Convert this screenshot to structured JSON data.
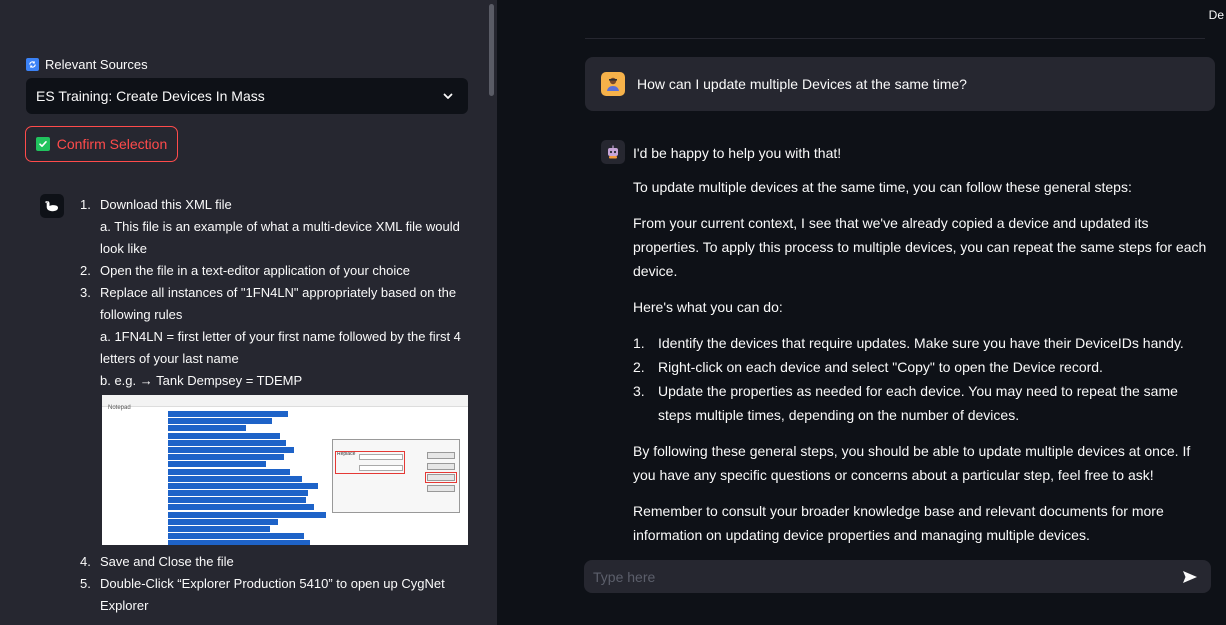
{
  "sidebar": {
    "sources_label": "Relevant Sources",
    "selected_source": "ES Training: Create Devices In Mass",
    "confirm_label": "Confirm Selection",
    "steps": [
      {
        "num": "1.",
        "text": "Download this XML file",
        "subs": [
          "a. This file is an example of what a multi-device XML file would look like"
        ]
      },
      {
        "num": "2.",
        "text": "Open the file in a text-editor application of your choice",
        "subs": []
      },
      {
        "num": "3.",
        "text": "Replace all instances of \"1FN4LN\" appropriately based on the following rules",
        "subs": [
          "a. 1FN4LN = first letter of your first name followed by the first 4 letters of your last name",
          "b. e.g. → Tank Dempsey = TDEMP"
        ]
      },
      {
        "num": "4.",
        "text": "Save and Close the file",
        "subs": []
      },
      {
        "num": "5.",
        "text": "Double-Click “Explorer Production 5410” to open up CygNet Explorer",
        "subs": []
      }
    ]
  },
  "main": {
    "top_right": "De",
    "user_message": "How can I update multiple Devices at the same time?",
    "bot": {
      "greeting": "I'd be happy to help you with that!",
      "p1": "To update multiple devices at the same time, you can follow these general steps:",
      "p2": "From your current context, I see that we've already copied a device and updated its properties. To apply this process to multiple devices, you can repeat the same steps for each device.",
      "p3": "Here's what you can do:",
      "list": [
        {
          "num": "1.",
          "text": "Identify the devices that require updates. Make sure you have their DeviceIDs handy."
        },
        {
          "num": "2.",
          "text": "Right-click on each device and select \"Copy\" to open the Device record."
        },
        {
          "num": "3.",
          "text": "Update the properties as needed for each device. You may need to repeat the same steps multiple times, depending on the number of devices."
        }
      ],
      "p4": "By following these general steps, you should be able to update multiple devices at once. If you have any specific questions or concerns about a particular step, feel free to ask!",
      "p5": "Remember to consult your broader knowledge base and relevant documents for more information on updating device properties and managing multiple devices."
    },
    "input_placeholder": "Type here"
  }
}
